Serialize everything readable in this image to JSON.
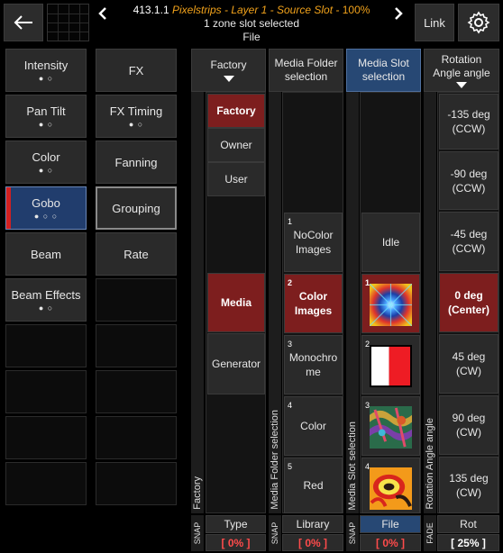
{
  "header": {
    "back_icon": "arrow-left-icon",
    "prev_icon": "chevron-left-icon",
    "next_icon": "chevron-right-icon",
    "id_label": "413.1.1",
    "title_orange": "Pixelstrips - Layer 1 - Source Slot -",
    "title_percent": "100%",
    "subtitle": "1 zone slot selected",
    "mode": "File",
    "link_label": "Link",
    "settings_icon": "gear-icon"
  },
  "features": [
    {
      "label": "Intensity",
      "dots": "● ○"
    },
    {
      "label": "FX",
      "dots": ""
    },
    {
      "label": "Pan Tilt",
      "dots": "● ○"
    },
    {
      "label": "FX Timing",
      "dots": "● ○"
    },
    {
      "label": "Color",
      "dots": "● ○"
    },
    {
      "label": "Fanning",
      "dots": ""
    },
    {
      "label": "Gobo",
      "dots": "● ○ ○"
    },
    {
      "label": "Grouping",
      "dots": ""
    },
    {
      "label": "Beam",
      "dots": ""
    },
    {
      "label": "Rate",
      "dots": ""
    },
    {
      "label": "Beam Effects",
      "dots": "● ○"
    },
    {
      "label": "",
      "dots": ""
    }
  ],
  "columns": {
    "type": {
      "header": "Factory",
      "strip_label": "Factory",
      "items": [
        "Factory",
        "Owner",
        "User",
        "Media",
        "Generator"
      ],
      "footer_label": "Type",
      "footer_value": "[ 0% ]"
    },
    "folder": {
      "header_l1": "Media Folder",
      "header_l2": "selection",
      "strip_label": "Media Folder selection",
      "items": [
        {
          "num": "1",
          "label": "NoColor Images"
        },
        {
          "num": "2",
          "label": "Color Images"
        },
        {
          "num": "3",
          "label": "Monochro me"
        },
        {
          "num": "4",
          "label": "Color"
        },
        {
          "num": "5",
          "label": "Red"
        }
      ],
      "footer_label": "Library",
      "footer_value": "[ 0% ]"
    },
    "slot": {
      "header_l1": "Media Slot",
      "header_l2": "selection",
      "strip_label": "Media Slot selection",
      "idle": "Idle",
      "nums": [
        "1",
        "2",
        "3",
        "4"
      ],
      "footer_label": "File",
      "footer_value": "[ 0% ]"
    },
    "rotation": {
      "header_l1": "Rotation",
      "header_l2": "Angle angle",
      "strip_label": "Rotation Angle angle",
      "items": [
        "-135 deg (CCW)",
        "-90 deg (CCW)",
        "-45 deg (CCW)",
        "0 deg (Center)",
        "45 deg (CW)",
        "90 deg (CW)",
        "135 deg (CW)"
      ],
      "footer_label": "Rot",
      "footer_value": "[ 25% ]"
    }
  },
  "snap_label": "SNAP",
  "fade_label": "FADE",
  "colors": {
    "accent_blue": "#274874",
    "active_red": "#7d1e1e",
    "orange": "#f1a21b"
  }
}
